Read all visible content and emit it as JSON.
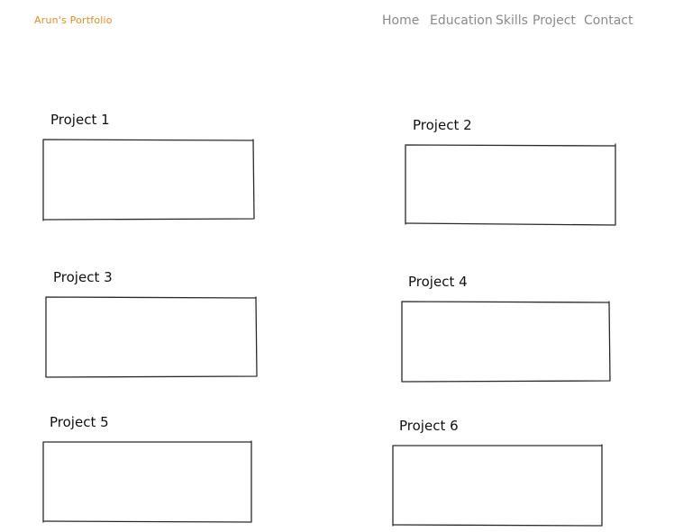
{
  "header": {
    "brand": "Arun's Portfolio",
    "nav": [
      "Home",
      "Education",
      "Skills",
      "Project",
      "Contact"
    ]
  },
  "projects": [
    {
      "title": "Project 1"
    },
    {
      "title": "Project 2"
    },
    {
      "title": "Project 3"
    },
    {
      "title": "Project 4"
    },
    {
      "title": "Project 5"
    },
    {
      "title": "Project 6"
    }
  ],
  "colors": {
    "brand": "#e0901e",
    "nav": "#8a8a8a",
    "stroke": "#2a2a2a"
  }
}
